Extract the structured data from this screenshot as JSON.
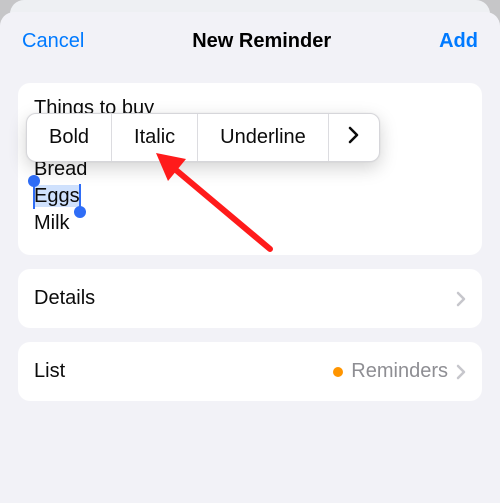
{
  "nav": {
    "cancel": "Cancel",
    "title": "New Reminder",
    "add": "Add"
  },
  "reminder": {
    "title": "Things to buy",
    "notes_lines": [
      "Bread",
      "Eggs",
      "Milk"
    ],
    "selected_line_index": 1
  },
  "format_popup": {
    "bold": "Bold",
    "italic": "Italic",
    "underline": "Underline"
  },
  "rows": {
    "details_label": "Details",
    "list_label": "List",
    "list_value": "Reminders",
    "list_color": "#ff9500"
  },
  "annotation": {
    "name": "red-arrow"
  }
}
